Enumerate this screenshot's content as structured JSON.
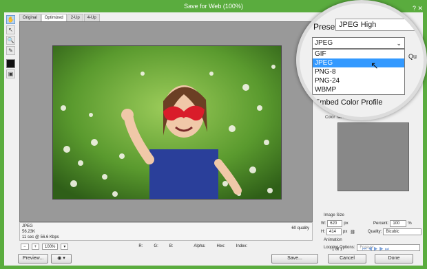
{
  "window": {
    "title": "Save for Web (100%)",
    "controls": "? ✕"
  },
  "tools": [
    "hand-icon",
    "slice-select-icon",
    "zoom-icon",
    "eyedropper-icon"
  ],
  "tabs": [
    "Original",
    "Optimized",
    "2-Up",
    "4-Up"
  ],
  "active_tab": "Optimized",
  "image_info": {
    "format": "JPEG",
    "size": "56.23K",
    "time": "11 sec @ 56.6 Kbps",
    "quality": "60 quality"
  },
  "status": {
    "zoom": "100%",
    "r": "R:",
    "g": "G:",
    "b": "B:",
    "alpha": "Alpha:",
    "hex": "Hex:",
    "index": "Index:"
  },
  "settings": {
    "preset_label": "Preset:",
    "preset_value": "JPEG High",
    "format_value": "JPEG",
    "format_options": [
      "GIF",
      "JPEG",
      "PNG-8",
      "PNG-24",
      "WBMP"
    ],
    "selected_format": "JPEG",
    "quality_partial": "Qu",
    "embed_profile": "Embed Color Profile",
    "color_table_label": "Color Table"
  },
  "image_size": {
    "label": "Image Size",
    "w_label": "W:",
    "w_value": "620",
    "h_label": "H:",
    "h_value": "414",
    "unit": "px",
    "percent_label": "Percent:",
    "percent_value": "100",
    "percent_unit": "%",
    "quality_label": "Quality:",
    "quality_value": "Bicubic"
  },
  "animation": {
    "label": "Animation",
    "looping_label": "Looping Options:",
    "looping_value": "Forever",
    "frame_counter": "1 of 1"
  },
  "buttons": {
    "preview": "Preview...",
    "save": "Save...",
    "cancel": "Cancel",
    "done": "Done"
  }
}
